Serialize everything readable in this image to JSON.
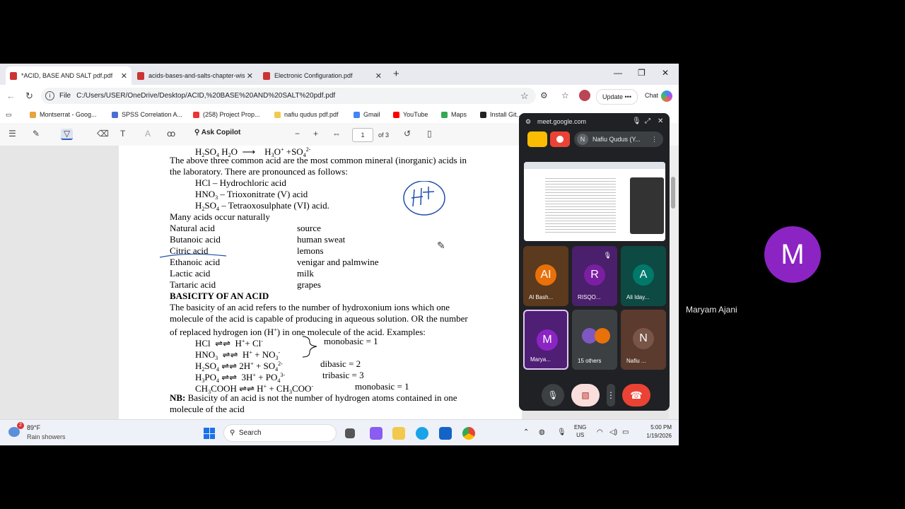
{
  "browser": {
    "tabs": [
      {
        "label": "*ACID, BASE AND SALT pdf.pdf",
        "active": true
      },
      {
        "label": "acids-bases-and-salts-chapter-wis",
        "active": false
      },
      {
        "label": "Electronic Configuration.pdf",
        "active": false
      }
    ],
    "url_scheme": "File",
    "url": "C:/Users/USER/OneDrive/Desktop/ACID,%20BASE%20AND%20SALT%20pdf.pdf",
    "update_label": "Update",
    "chat_label": "Chat",
    "bookmarks": [
      "Montserrat - Goog...",
      "SPSS Correlation A...",
      "(258) Project Prop...",
      "nafiu qudus pdf.pdf",
      "Gmail",
      "YouTube",
      "Maps",
      "Install Git..."
    ]
  },
  "pdf_toolbar": {
    "ask_copilot": "Ask Copilot",
    "page_current": "1",
    "page_of": "of 3"
  },
  "document": {
    "line_eq1_left": "H",
    "line_intro": "The above three common acid are the most common mineral (inorganic) acids in",
    "line_intro2": "the laboratory. There are pronounced as follows:",
    "acids": [
      "HCl – Hydrochloric acid",
      "HNO",
      "– Trioxonitrate (V) acid",
      "H",
      "SO",
      "– Tetraoxosulphate (VI) acid."
    ],
    "natural_heading": "Many acids occur naturally",
    "natural_table": [
      {
        "acid": "Natural acid",
        "source": "source"
      },
      {
        "acid": "Butanoic acid",
        "source": "human sweat"
      },
      {
        "acid": "Citric acid",
        "source": "lemons"
      },
      {
        "acid": "Ethanoic acid",
        "source": "venigar and palmwine"
      },
      {
        "acid": "Lactic acid",
        "source": "milk"
      },
      {
        "acid": "Tartaric acid",
        "source": "grapes"
      }
    ],
    "basicity_heading": "BASICITY OF AN ACID",
    "basicity_p1": "The basicity of an acid refers to the number of hydroxonium ions which one",
    "basicity_p2": "molecule of the acid is capable of producing in aqueous solution. OR the number",
    "basicity_p3": "of replaced hydrogen ion (H",
    "basicity_p3b": ") in one molecule of the acid. Examples:",
    "monobasic1": "monobasic = 1",
    "dibasic": "dibasic = 2",
    "tribasic": "tribasic = 3",
    "monobasic2": "monobasic = 1",
    "nb_label": "NB:",
    "nb_text": "Basicity of an acid is not the number of hydrogen atoms contained in one",
    "nb_text2": "molecule of the acid"
  },
  "taskbar": {
    "temp": "89°F",
    "condition": "Rain showers",
    "weather_badge": "2",
    "search": "Search",
    "lang1": "ENG",
    "lang2": "US",
    "time": "5:00 PM",
    "date": "1/19/2026"
  },
  "meet": {
    "url": "meet.google.com",
    "presenter_initial": "N",
    "presenter": "Nafiu Qudus (Y...",
    "tiles": [
      {
        "initials": "AI",
        "name": "Al Bash...",
        "color": "#e8710a"
      },
      {
        "initials": "R",
        "name": "RISQO...",
        "color": "#7b1fa2"
      },
      {
        "initials": "A",
        "name": "Ali Iday...",
        "color": "#00796b"
      },
      {
        "initials": "M",
        "name": "Marya...",
        "color": "#8c24c4"
      },
      {
        "initials": "",
        "name": "15 others",
        "color": "#3c4043"
      },
      {
        "initials": "N",
        "name": "Nafiu ...",
        "color": "#795548"
      }
    ]
  },
  "participant": {
    "initial": "M",
    "name": "Maryam Ajani"
  }
}
